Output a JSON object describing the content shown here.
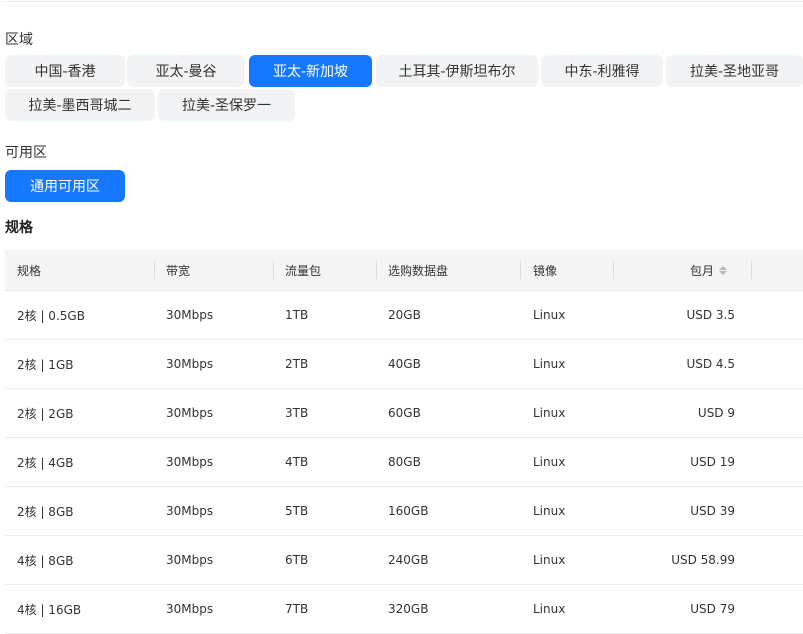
{
  "region": {
    "label": "区域",
    "options": [
      "中国-香港",
      "亚太-曼谷",
      "亚太-新加坡",
      "土耳其-伊斯坦布尔",
      "中东-利雅得",
      "拉美-圣地亚哥",
      "拉美-墨西哥城二",
      "拉美-圣保罗一"
    ],
    "selected": "亚太-新加坡"
  },
  "zone": {
    "label": "可用区",
    "options": [
      "通用可用区"
    ],
    "selected": "通用可用区"
  },
  "spec_title": "规格",
  "table": {
    "columns": [
      "规格",
      "带宽",
      "流量包",
      "选购数据盘",
      "镜像",
      "包月"
    ],
    "rows": [
      [
        "2核 | 0.5GB",
        "30Mbps",
        "1TB",
        "20GB",
        "Linux",
        "USD 3.5"
      ],
      [
        "2核 | 1GB",
        "30Mbps",
        "2TB",
        "40GB",
        "Linux",
        "USD 4.5"
      ],
      [
        "2核 | 2GB",
        "30Mbps",
        "3TB",
        "60GB",
        "Linux",
        "USD 9"
      ],
      [
        "2核 | 4GB",
        "30Mbps",
        "4TB",
        "80GB",
        "Linux",
        "USD 19"
      ],
      [
        "2核 | 8GB",
        "30Mbps",
        "5TB",
        "160GB",
        "Linux",
        "USD 39"
      ],
      [
        "4核 | 8GB",
        "30Mbps",
        "6TB",
        "240GB",
        "Linux",
        "USD 58.99"
      ],
      [
        "4核 | 16GB",
        "30Mbps",
        "7TB",
        "320GB",
        "Linux",
        "USD 79"
      ]
    ]
  },
  "colors": {
    "accent": "#1677ff",
    "chip_bg": "#f2f3f5",
    "header_bg": "#f5f5f5"
  },
  "icons": {
    "sort": "sort-caret-icon"
  }
}
